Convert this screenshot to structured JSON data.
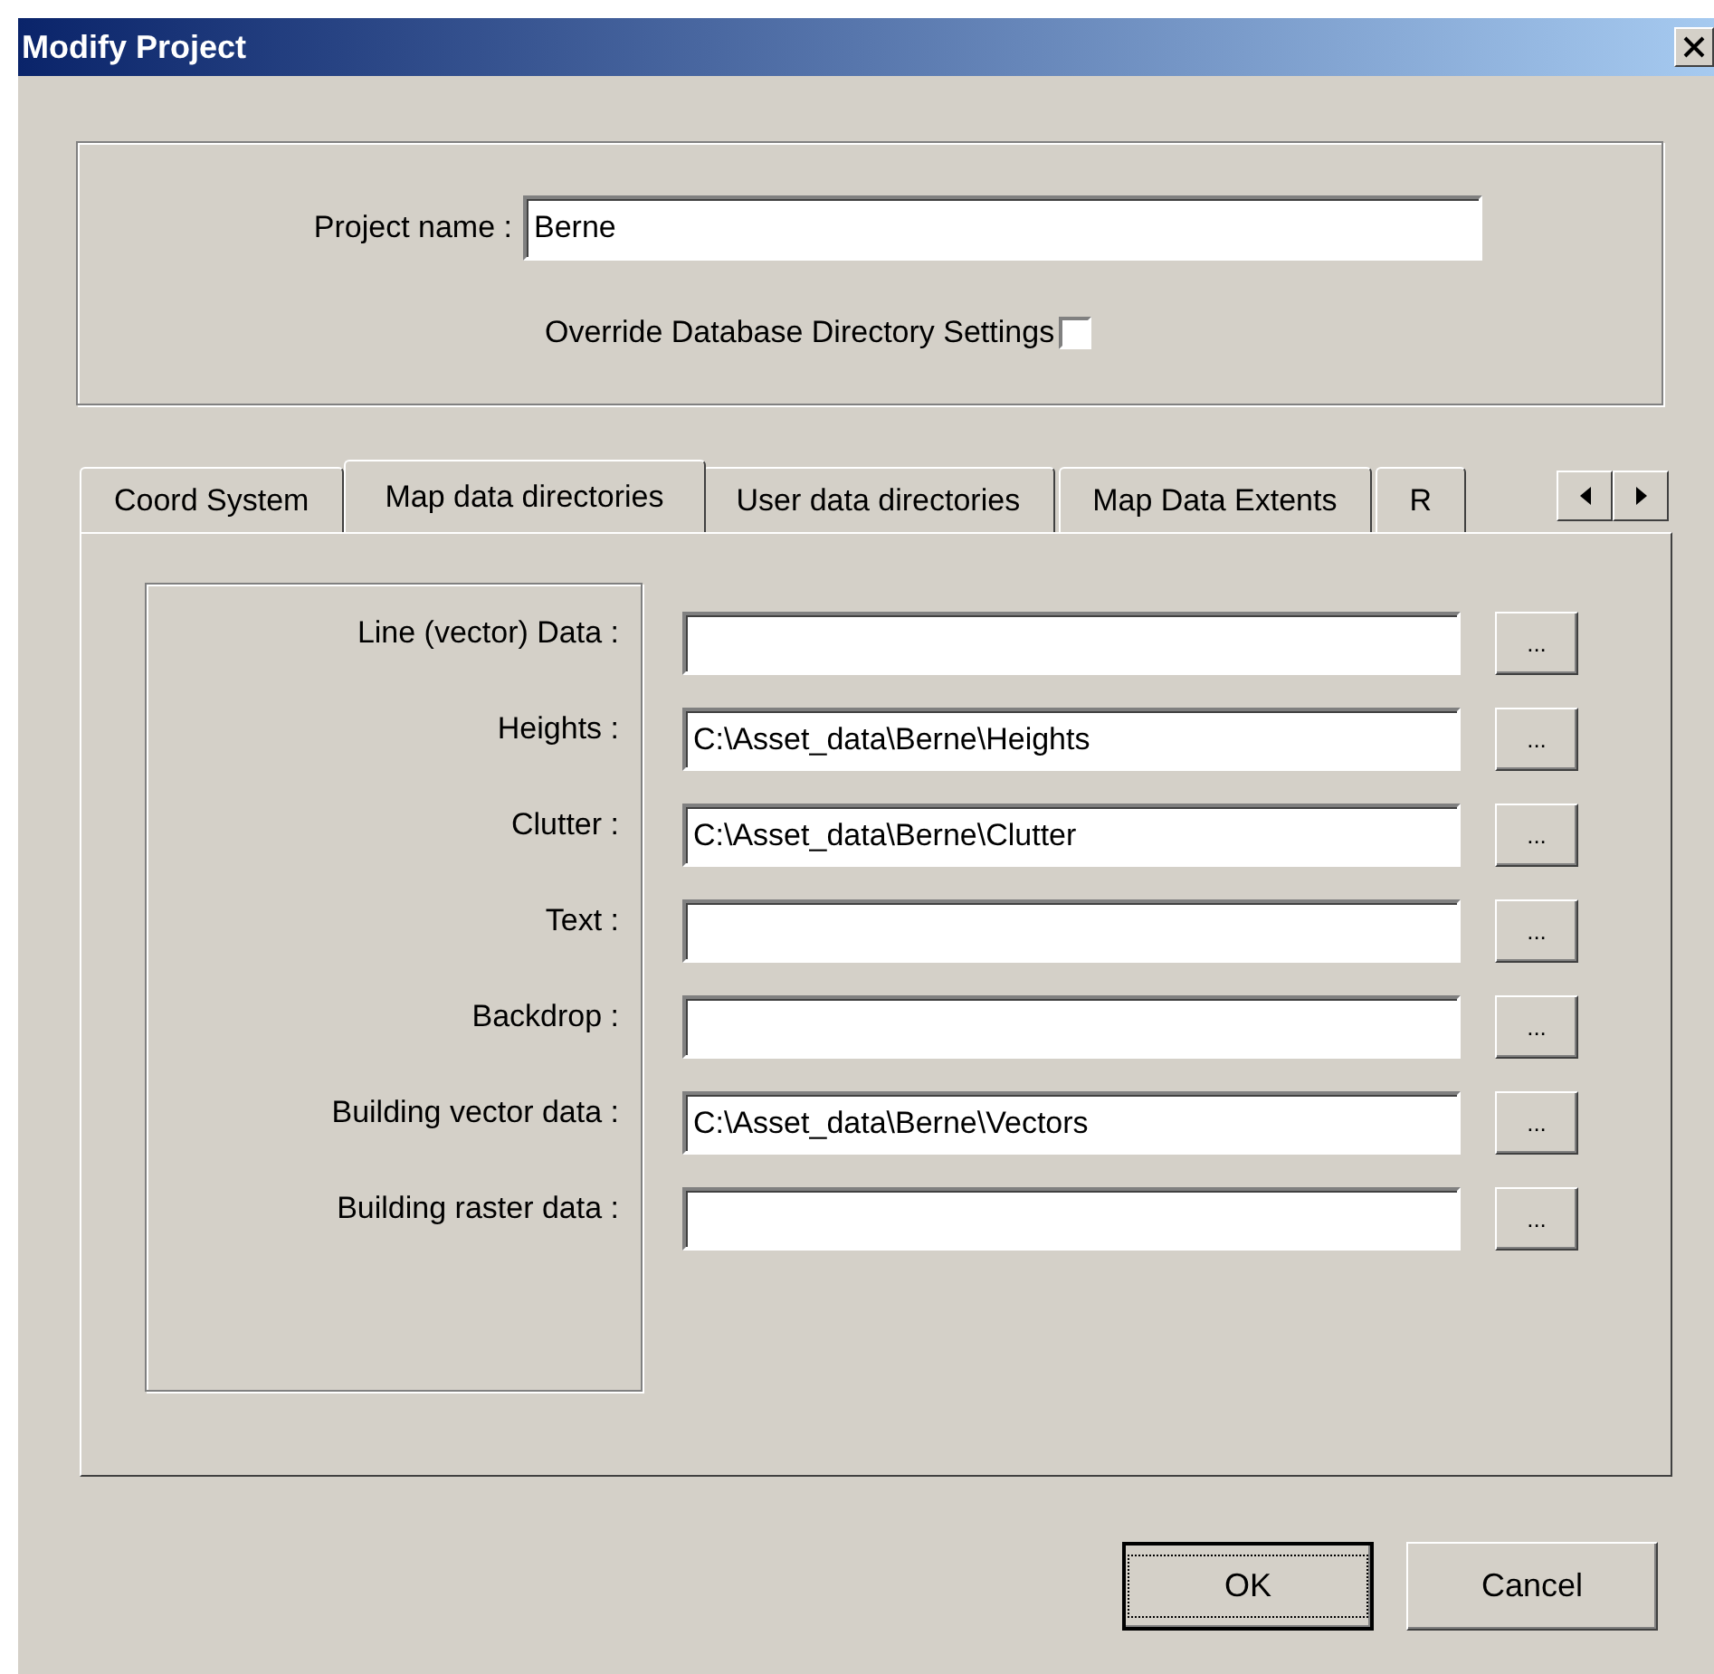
{
  "window": {
    "title": "Modify Project"
  },
  "project": {
    "label": "Project name :",
    "value": "Berne"
  },
  "override": {
    "label": "Override Database Directory Settings",
    "checked": false
  },
  "tabs": [
    {
      "label": "Coord System",
      "selected": false
    },
    {
      "label": "Map data directories",
      "selected": true
    },
    {
      "label": "User data directories",
      "selected": false
    },
    {
      "label": "Map Data Extents",
      "selected": false
    },
    {
      "label": "R",
      "selected": false
    }
  ],
  "fields": [
    {
      "label": "Line (vector) Data :",
      "browse": "..."
    },
    {
      "label": "Heights :",
      "value": "C:\\Asset_data\\Berne\\Heights",
      "browse": "..."
    },
    {
      "label": "Clutter :",
      "value": "C:\\Asset_data\\Berne\\Clutter",
      "browse": "..."
    },
    {
      "label": "Text :",
      "browse": "..."
    },
    {
      "label": "Backdrop :",
      "browse": "..."
    },
    {
      "label": "Building vector data :",
      "value": "C:\\Asset_data\\Berne\\Vectors",
      "browse": "..."
    },
    {
      "label": "Building raster data :",
      "browse": "..."
    }
  ],
  "buttons": [
    {
      "label": "OK",
      "default": true
    },
    {
      "label": "Cancel",
      "default": false
    }
  ]
}
